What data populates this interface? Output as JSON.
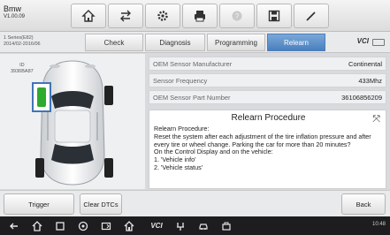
{
  "header": {
    "brand": "Bmw",
    "version": "V1.00.09",
    "toolbar_icons": [
      "home-icon",
      "vehicle-swap-icon",
      "settings-icon",
      "print-icon",
      "help-icon",
      "save-icon",
      "edit-icon"
    ]
  },
  "vehicle": {
    "series": "1 Series(E82)",
    "dates": "2014/02-2016/06"
  },
  "tabs": [
    {
      "label": "Check",
      "active": false
    },
    {
      "label": "Diagnosis",
      "active": false
    },
    {
      "label": "Programming",
      "active": false
    },
    {
      "label": "Relearn",
      "active": true
    }
  ],
  "vci_label": "VCI",
  "sensor": {
    "id_label": "ID",
    "id_value": "3936BA87"
  },
  "info_rows": [
    {
      "label": "OEM Sensor Manufacturer",
      "value": "Continental"
    },
    {
      "label": "Sensor Frequency",
      "value": "433Mhz"
    },
    {
      "label": "OEM Sensor Part Number",
      "value": "36106856209"
    }
  ],
  "procedure": {
    "title": "Relearn Procedure",
    "body": "Relearn Procedure:\nReset the system after each adjustment of the tire inflation pressure and after every tire or wheel change. Parking the car for more than 20 minutes?\nOn the Control Display and on the vehicle:\n1. 'Vehicle info'\n2. 'Vehicle status'"
  },
  "actions": {
    "trigger": "Trigger",
    "clear_dtcs": "Clear DTCs",
    "back": "Back"
  },
  "navbar": {
    "vci_label": "VCI",
    "clock": "10:48"
  },
  "colors": {
    "accent": "#4a7fbe",
    "selected_tire": "#2eaa2e",
    "nav_background": "#1d1d1f"
  }
}
